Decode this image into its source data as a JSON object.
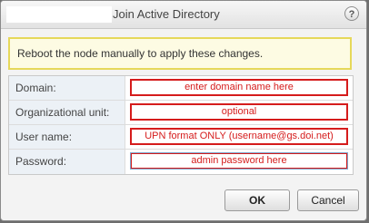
{
  "dialog": {
    "title": "Join Active Directory",
    "help_glyph": "?"
  },
  "banner": {
    "message": "Reboot the node manually to apply these changes."
  },
  "form": {
    "rows": [
      {
        "label": "Domain:",
        "value": "enter domain name here"
      },
      {
        "label": "Organizational unit:",
        "value": "optional"
      },
      {
        "label": "User name:",
        "value": "UPN format ONLY (username@gs.doi.net)"
      },
      {
        "label": "Password:",
        "value": "admin password here"
      }
    ]
  },
  "buttons": {
    "ok": "OK",
    "cancel": "Cancel"
  },
  "colors": {
    "annotation_red": "#d51c1c",
    "banner_border": "#e6d85a",
    "banner_bg": "#fdfbe3",
    "label_bg": "#ecf1f6"
  }
}
